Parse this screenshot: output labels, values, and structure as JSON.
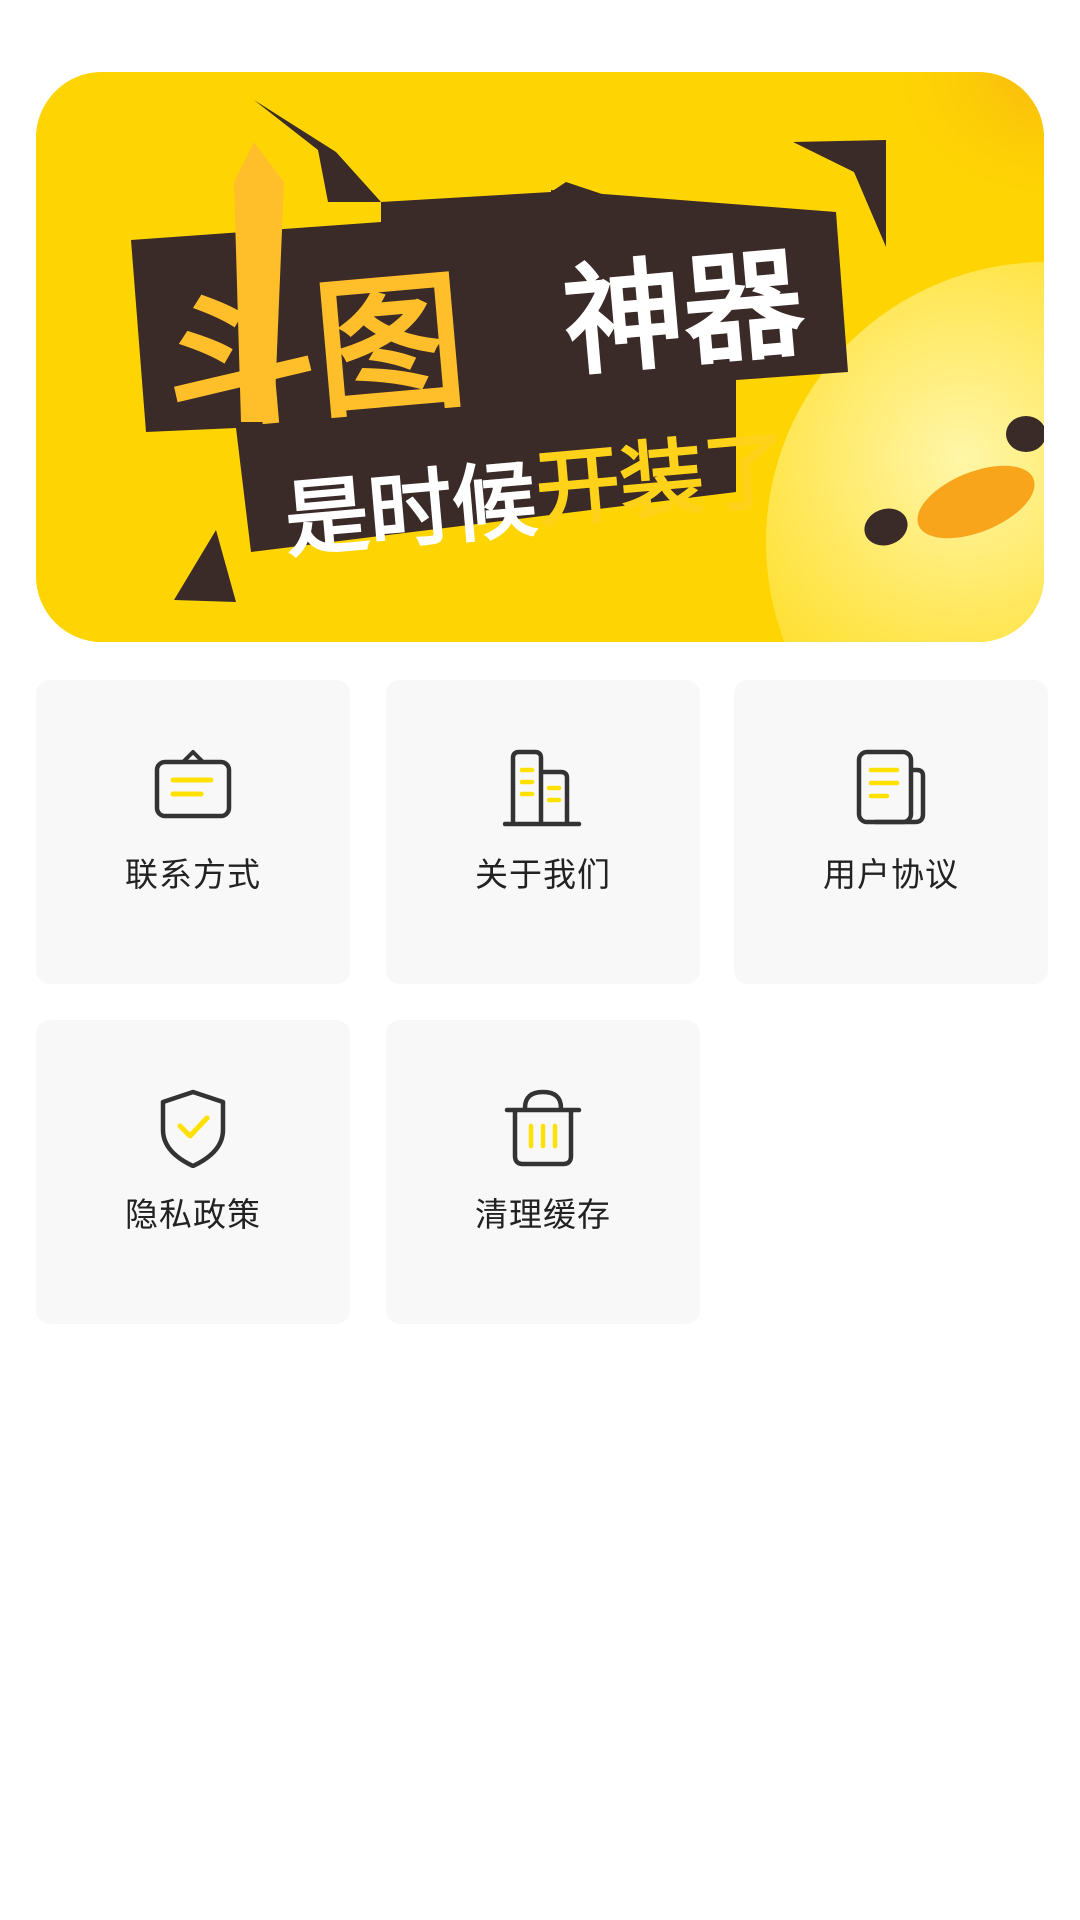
{
  "banner": {
    "title_main": "斗图",
    "title_sub": "神器",
    "slogan_part1": "是时候",
    "slogan_part2": "开装了",
    "colors": {
      "background": "#fed503",
      "dark": "#3a2a28",
      "accent": "#ffbf2a",
      "white": "#ffffff"
    }
  },
  "menu": {
    "items": [
      {
        "label": "联系方式",
        "icon": "contact-sign-icon"
      },
      {
        "label": "关于我们",
        "icon": "building-icon"
      },
      {
        "label": "用户协议",
        "icon": "document-icon"
      },
      {
        "label": "隐私政策",
        "icon": "shield-check-icon"
      },
      {
        "label": "清理缓存",
        "icon": "trash-bin-icon"
      }
    ]
  },
  "colors": {
    "icon_stroke": "#333333",
    "icon_accent": "#ffe100",
    "tile_bg": "#f8f8f8"
  }
}
